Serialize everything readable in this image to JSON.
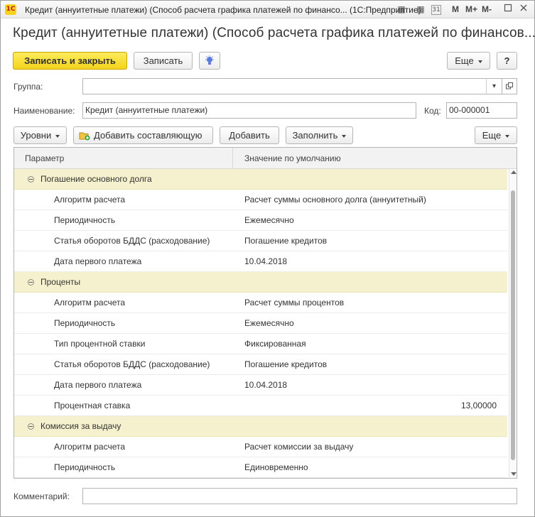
{
  "window": {
    "app_logo": "1С",
    "title": "Кредит (аннуитетные платежи) (Способ расчета графика платежей по финансо...  (1С:Предприятие)",
    "icons": [
      "document-icon",
      "calculator-icon",
      "calendar-icon"
    ],
    "calendar_label": "31",
    "memory_buttons": [
      "M",
      "M+",
      "M-"
    ]
  },
  "heading": "Кредит (аннуитетные платежи) (Способ расчета графика платежей по финансов...",
  "toolbar": {
    "save_close": "Записать и закрыть",
    "save": "Записать",
    "more": "Еще",
    "help": "?"
  },
  "form": {
    "group_label": "Группа:",
    "group_value": "",
    "name_label": "Наименование:",
    "name_value": "Кредит (аннуитетные платежи)",
    "code_label": "Код:",
    "code_value": "00-000001",
    "comment_label": "Комментарий:",
    "comment_value": ""
  },
  "table_toolbar": {
    "levels": "Уровни",
    "add_component": "Добавить составляющую",
    "add": "Добавить",
    "fill": "Заполнить",
    "more": "Еще"
  },
  "table": {
    "columns": [
      "Параметр",
      "Значение по умолчанию"
    ],
    "groups": [
      {
        "name": "Погашение основного долга",
        "rows": [
          {
            "param": "Алгоритм расчета",
            "value": "Расчет суммы основного долга (аннуитетный)"
          },
          {
            "param": "Периодичность",
            "value": "Ежемесячно"
          },
          {
            "param": "Статья оборотов БДДС (расходование)",
            "value": "Погашение кредитов"
          },
          {
            "param": "Дата первого платежа",
            "value": "10.04.2018"
          }
        ]
      },
      {
        "name": "Проценты",
        "rows": [
          {
            "param": "Алгоритм расчета",
            "value": "Расчет суммы процентов"
          },
          {
            "param": "Периодичность",
            "value": "Ежемесячно"
          },
          {
            "param": "Тип процентной ставки",
            "value": "Фиксированная"
          },
          {
            "param": "Статья оборотов БДДС (расходование)",
            "value": "Погашение кредитов"
          },
          {
            "param": "Дата первого платежа",
            "value": "10.04.2018"
          },
          {
            "param": "Процентная ставка",
            "value": "13,00000",
            "numeric": true
          }
        ]
      },
      {
        "name": "Комиссия за выдачу",
        "rows": [
          {
            "param": "Алгоритм расчета",
            "value": "Расчет комиссии за выдачу"
          },
          {
            "param": "Периодичность",
            "value": "Единовременно"
          }
        ]
      }
    ]
  },
  "colors": {
    "primary_button": "#f4d31c",
    "group_row": "#f5f0cd"
  }
}
